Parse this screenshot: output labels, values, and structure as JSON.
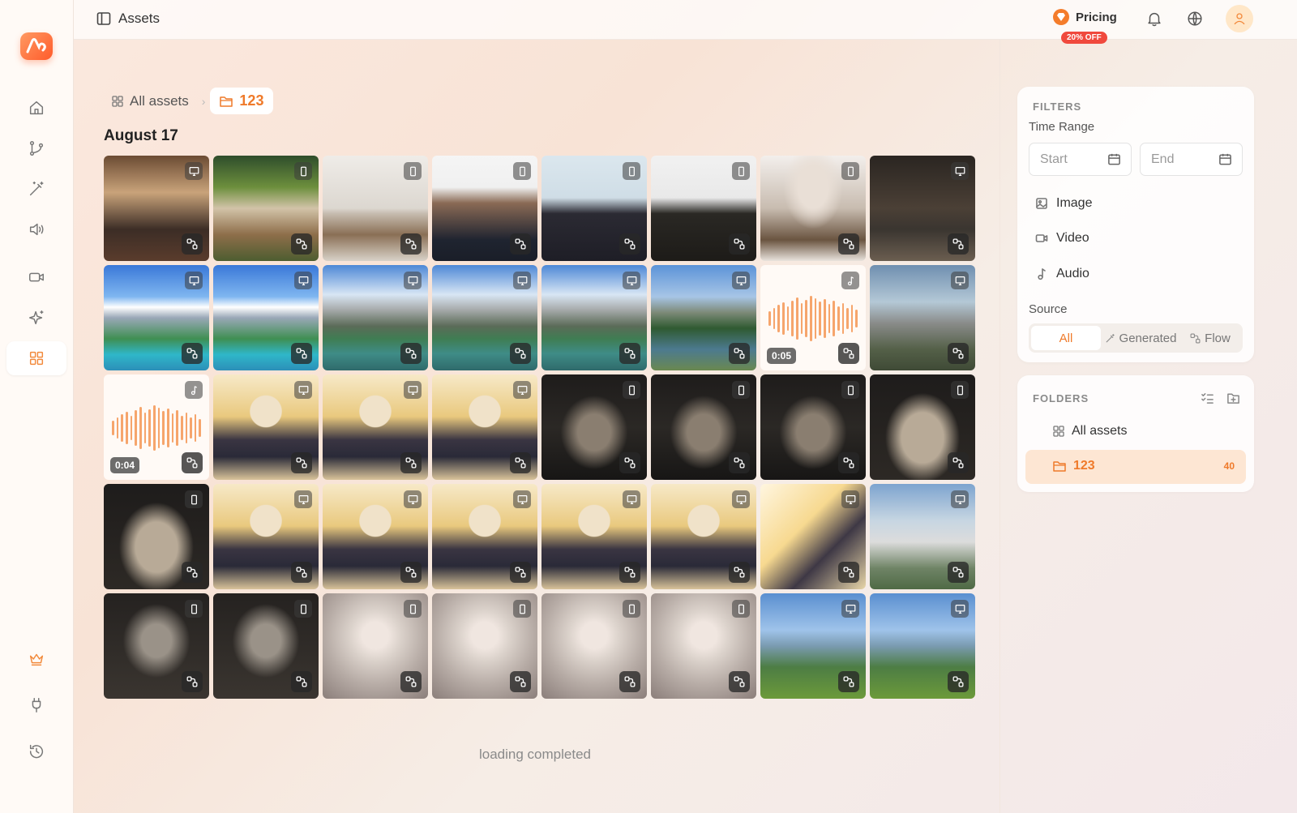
{
  "app": {
    "accent": "#ef7a2a",
    "logo_icon": "app-logo-icon"
  },
  "topbar": {
    "title": "Assets",
    "pricing_label": "Pricing",
    "discount_badge": "20% OFF"
  },
  "sidebar": {
    "items": [
      {
        "name": "home",
        "icon": "home-icon"
      },
      {
        "name": "workflow",
        "icon": "branch-icon"
      },
      {
        "name": "magic",
        "icon": "wand-icon"
      },
      {
        "name": "audio",
        "icon": "speaker-icon"
      },
      {
        "name": "video",
        "icon": "video-icon"
      },
      {
        "name": "sparkle",
        "icon": "sparkle-icon"
      },
      {
        "name": "assets",
        "icon": "grid-icon",
        "active": true
      },
      {
        "name": "premium",
        "icon": "crown-icon"
      },
      {
        "name": "plugins",
        "icon": "plug-icon"
      },
      {
        "name": "history",
        "icon": "history-icon"
      }
    ]
  },
  "breadcrumb": {
    "all_label": "All assets",
    "folder_label": "123"
  },
  "main": {
    "date_heading": "August 17",
    "loading_text": "loading completed",
    "tiles": [
      {
        "style": "t-maid",
        "badge": "desktop"
      },
      {
        "style": "t-garden",
        "badge": "mobile"
      },
      {
        "style": "t-swords",
        "badge": "mobile"
      },
      {
        "style": "t-faces",
        "badge": "mobile"
      },
      {
        "style": "t-anime",
        "badge": "mobile"
      },
      {
        "style": "t-robe",
        "badge": "mobile"
      },
      {
        "style": "t-lady",
        "badge": "mobile"
      },
      {
        "style": "t-boots",
        "badge": "desktop"
      },
      {
        "style": "t-sky",
        "badge": "desktop"
      },
      {
        "style": "t-sky",
        "badge": "desktop"
      },
      {
        "style": "t-lake",
        "badge": "desktop"
      },
      {
        "style": "t-lake",
        "badge": "desktop"
      },
      {
        "style": "t-lake",
        "badge": "desktop"
      },
      {
        "style": "t-river",
        "badge": "desktop"
      },
      {
        "style": "t-audio",
        "badge": "music",
        "duration": "0:05"
      },
      {
        "style": "t-knight",
        "badge": "desktop"
      },
      {
        "style": "t-audio",
        "badge": "music",
        "duration": "0:04"
      },
      {
        "style": "t-girlW",
        "badge": "desktop"
      },
      {
        "style": "t-girlW",
        "badge": "desktop"
      },
      {
        "style": "t-girlW",
        "badge": "desktop"
      },
      {
        "style": "t-dark",
        "badge": "mobile"
      },
      {
        "style": "t-dark",
        "badge": "mobile"
      },
      {
        "style": "t-dark",
        "badge": "mobile"
      },
      {
        "style": "t-gown",
        "badge": "mobile"
      },
      {
        "style": "t-gown",
        "badge": "mobile"
      },
      {
        "style": "t-girlW",
        "badge": "desktop"
      },
      {
        "style": "t-girlW",
        "badge": "desktop"
      },
      {
        "style": "t-girlW",
        "badge": "desktop"
      },
      {
        "style": "t-girlW",
        "badge": "desktop"
      },
      {
        "style": "t-girlW",
        "badge": "desktop"
      },
      {
        "style": "t-warm",
        "badge": "desktop"
      },
      {
        "style": "t-cape",
        "badge": "desktop"
      },
      {
        "style": "t-knightDark",
        "badge": "mobile"
      },
      {
        "style": "t-knightDark",
        "badge": "mobile"
      },
      {
        "style": "t-silver",
        "badge": "mobile"
      },
      {
        "style": "t-silver",
        "badge": "mobile"
      },
      {
        "style": "t-silver",
        "badge": "mobile"
      },
      {
        "style": "t-silver",
        "badge": "mobile"
      },
      {
        "style": "t-float",
        "badge": "desktop"
      },
      {
        "style": "t-float",
        "badge": "desktop"
      }
    ]
  },
  "filters": {
    "title": "FILTERS",
    "time_range_label": "Time Range",
    "start_placeholder": "Start",
    "end_placeholder": "End",
    "types": [
      {
        "label": "Image",
        "icon": "image-icon"
      },
      {
        "label": "Video",
        "icon": "video-icon"
      },
      {
        "label": "Audio",
        "icon": "music-note-icon"
      }
    ],
    "source_label": "Source",
    "source_options": [
      "All",
      "Generated",
      "Flow"
    ],
    "source_selected": "All"
  },
  "folders": {
    "title": "FOLDERS",
    "all_label": "All assets",
    "current": {
      "label": "123",
      "count": "40"
    }
  }
}
